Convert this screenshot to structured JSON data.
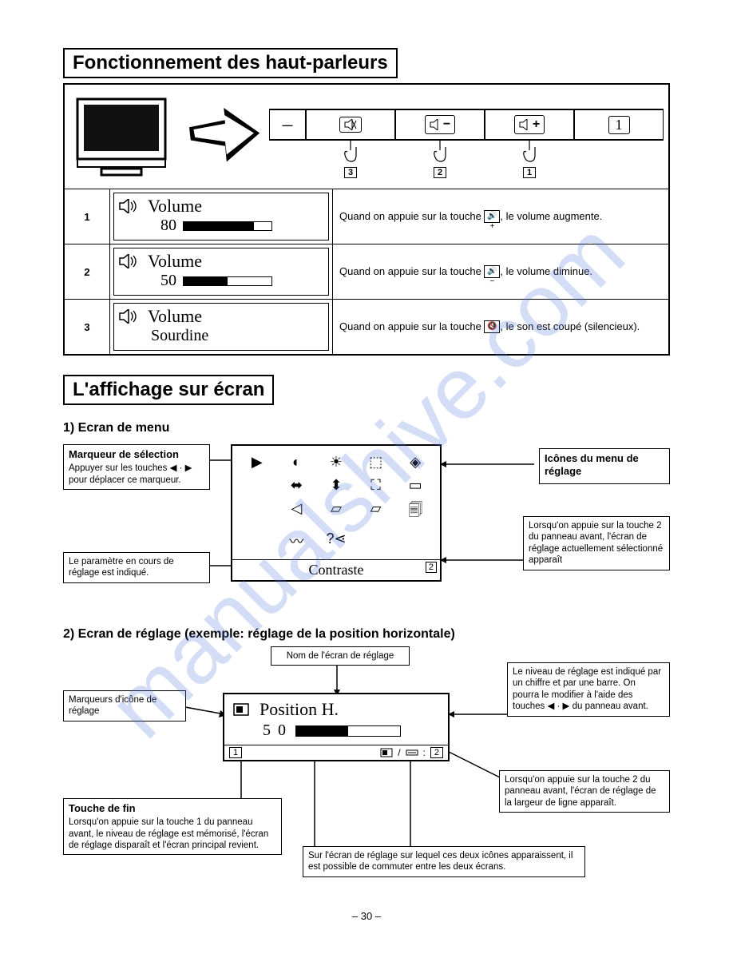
{
  "watermark": "manualshive.com",
  "section1": {
    "title": "Fonctionnement des haut-parleurs",
    "buttons": {
      "mute": "✕",
      "vol_down_label": "−",
      "vol_up_label": "+",
      "one": "1"
    },
    "hands": {
      "h1": "1",
      "h2": "2",
      "h3": "3"
    },
    "rows": [
      {
        "num": "1",
        "osd_label": "Volume",
        "osd_value": "80",
        "bar_pct": 80,
        "desc_a": "Quand on appuie sur la touche ",
        "desc_b": ", le volume augmente."
      },
      {
        "num": "2",
        "osd_label": "Volume",
        "osd_value": "50",
        "bar_pct": 50,
        "desc_a": "Quand on appuie sur la touche ",
        "desc_b": ", le volume diminue."
      },
      {
        "num": "3",
        "osd_label": "Volume",
        "osd_value": "Sourdine",
        "bar_pct": null,
        "desc_a": "Quand on appuie sur la touche ",
        "desc_b": ", le son est coupé (silencieux)."
      }
    ]
  },
  "section2": {
    "title": "L'affichage sur écran",
    "sub1": "1) Ecran de menu",
    "callouts1": {
      "sel_marker_title": "Marqueur de sélection",
      "sel_marker_body": "Appuyer sur les touches ◀ · ▶ pour déplacer ce marqueur.",
      "param_body": "Le paramètre en cours de réglage est indiqué.",
      "icons_title": "Icônes du menu de réglage",
      "press2_body": "Lorsqu'on appuie sur la touche 2 du panneau avant, l'écran de réglage actuellement sélectionné apparaît"
    },
    "menu_label": "Contraste",
    "menu_corner": "2",
    "sub2": "2) Ecran de réglage (exemple: réglage de la position horizontale)",
    "callouts2": {
      "name_label": "Nom de l'écran de réglage",
      "markers_label": "Marqueurs d'icône de réglage",
      "level_body": "Le niveau de réglage est indiqué par un chiffre et par une barre. On pourra le modifier à l'aide des touches ◀ · ▶ du panneau avant.",
      "press2b_body": "Lorsqu'on appuie sur la touche 2 du panneau avant, l'écran de réglage de la largeur de ligne apparaît.",
      "end_title": "Touche de fin",
      "end_body": "Lorsqu'on appuie sur la touche 1 du panneau avant, le niveau de réglage est mémorisé, l'écran de réglage disparaît et l'écran principal revient.",
      "switch_body": "Sur l'écran de réglage sur lequel ces deux icônes apparaissent, il est possible de commuter entre les deux écrans."
    },
    "adj": {
      "title": "Position  H.",
      "value": "5 0",
      "left_num": "1",
      "right_num": "2"
    }
  },
  "page_number": "– 30 –"
}
